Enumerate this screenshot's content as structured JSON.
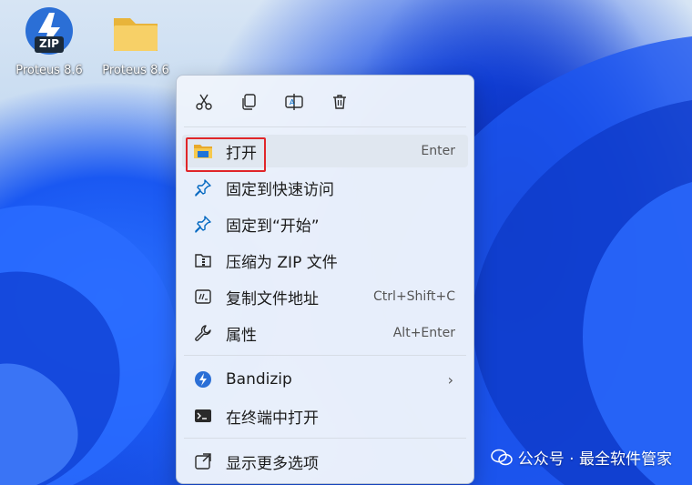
{
  "desktop": {
    "icons": [
      {
        "label": "Proteus 8.6",
        "kind": "zip-archive-icon",
        "badge": "ZIP"
      },
      {
        "label": "Proteus 8.6",
        "kind": "folder-icon"
      }
    ]
  },
  "context_menu": {
    "toolbar": [
      {
        "name": "cut-icon"
      },
      {
        "name": "copy-icon"
      },
      {
        "name": "rename-icon"
      },
      {
        "name": "delete-icon"
      }
    ],
    "items": [
      {
        "label": "打开",
        "shortcut": "Enter",
        "icon": "folder-open-icon"
      },
      {
        "label": "固定到快速访问",
        "shortcut": "",
        "icon": "pin-icon"
      },
      {
        "label": "固定到“开始”",
        "shortcut": "",
        "icon": "pin-icon"
      },
      {
        "label": "压缩为 ZIP 文件",
        "shortcut": "",
        "icon": "zip-folder-icon"
      },
      {
        "label": "复制文件地址",
        "shortcut": "Ctrl+Shift+C",
        "icon": "path-icon"
      },
      {
        "label": "属性",
        "shortcut": "Alt+Enter",
        "icon": "wrench-icon"
      },
      {
        "label": "Bandizip",
        "shortcut": "",
        "icon": "bandizip-icon",
        "submenu": true
      },
      {
        "label": "在终端中打开",
        "shortcut": "",
        "icon": "terminal-icon"
      },
      {
        "label": "显示更多选项",
        "shortcut": "",
        "icon": "more-options-icon"
      }
    ],
    "submenu_arrow": "›"
  },
  "watermark": {
    "text": "公众号 · 最全软件管家"
  },
  "colors": {
    "accent": "#0067c0",
    "highlight": "#e0262a",
    "menu_bg": "#eef4fb"
  }
}
